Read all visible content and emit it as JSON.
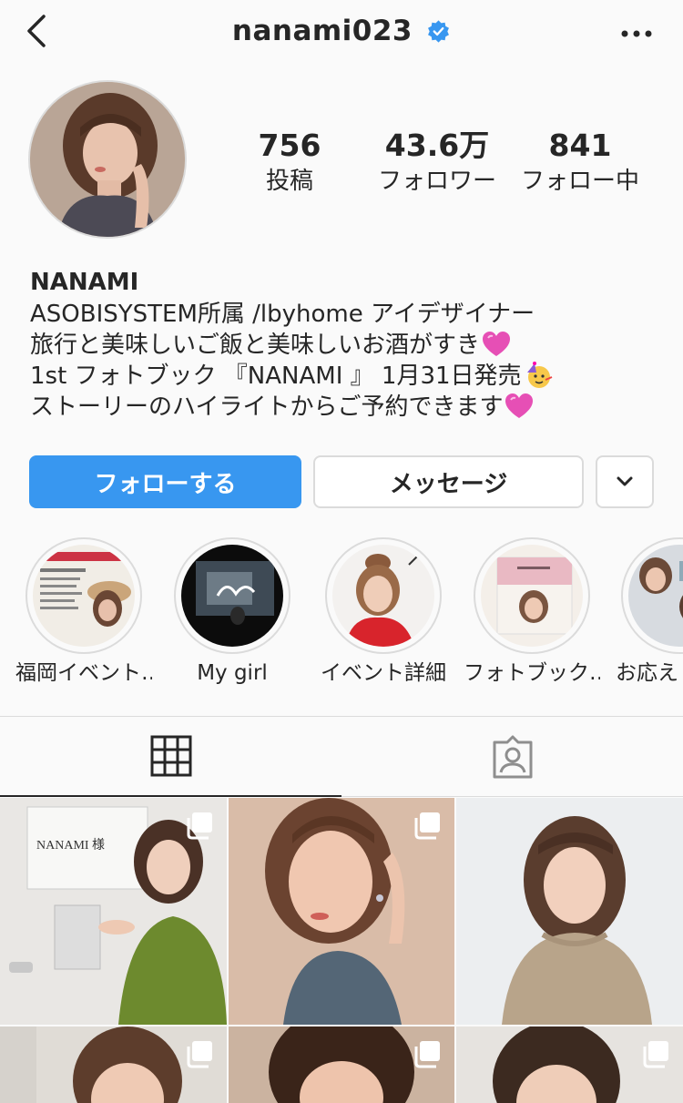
{
  "header": {
    "username": "nanami023",
    "back_icon": "chevron-left-icon",
    "verified_icon": "verified-badge-icon",
    "more_icon": "more-horizontal-icon"
  },
  "profile": {
    "stats": {
      "posts_count": "756",
      "posts_label": "投稿",
      "followers_count": "43.6万",
      "followers_label": "フォロワー",
      "following_count": "841",
      "following_label": "フォロー中"
    },
    "bio": {
      "name": "NANAMI",
      "line1": "ASOBISYSTEM所属 /lbyhome アイデザイナー",
      "line2": "旅行と美味しいご飯と美味しいお酒がすき",
      "line3": "1st フォトブック 『NANAMI 』 1月31日発売",
      "line4": "ストーリーのハイライトからご予約できます"
    }
  },
  "actions": {
    "follow_label": "フォローする",
    "message_label": "メッセージ",
    "more_icon": "chevron-down-icon"
  },
  "highlights": [
    {
      "label": "福岡イベント…"
    },
    {
      "label": "My  girl"
    },
    {
      "label": "イベント詳細"
    },
    {
      "label": "フォトブック…"
    },
    {
      "label": "お応えし"
    }
  ],
  "tabs": [
    {
      "name": "grid",
      "icon": "grid-icon",
      "active": true
    },
    {
      "name": "tagged",
      "icon": "tagged-person-icon",
      "active": false
    }
  ],
  "posts": [
    {
      "multiple": true,
      "caption_text": "NANAMI 様"
    },
    {
      "multiple": true
    },
    {
      "multiple": false
    },
    {
      "multiple": true
    },
    {
      "multiple": true
    },
    {
      "multiple": true
    }
  ],
  "colors": {
    "accent": "#3897f0",
    "text": "#262626",
    "border": "#dbdbdb",
    "background": "#fafafa"
  }
}
